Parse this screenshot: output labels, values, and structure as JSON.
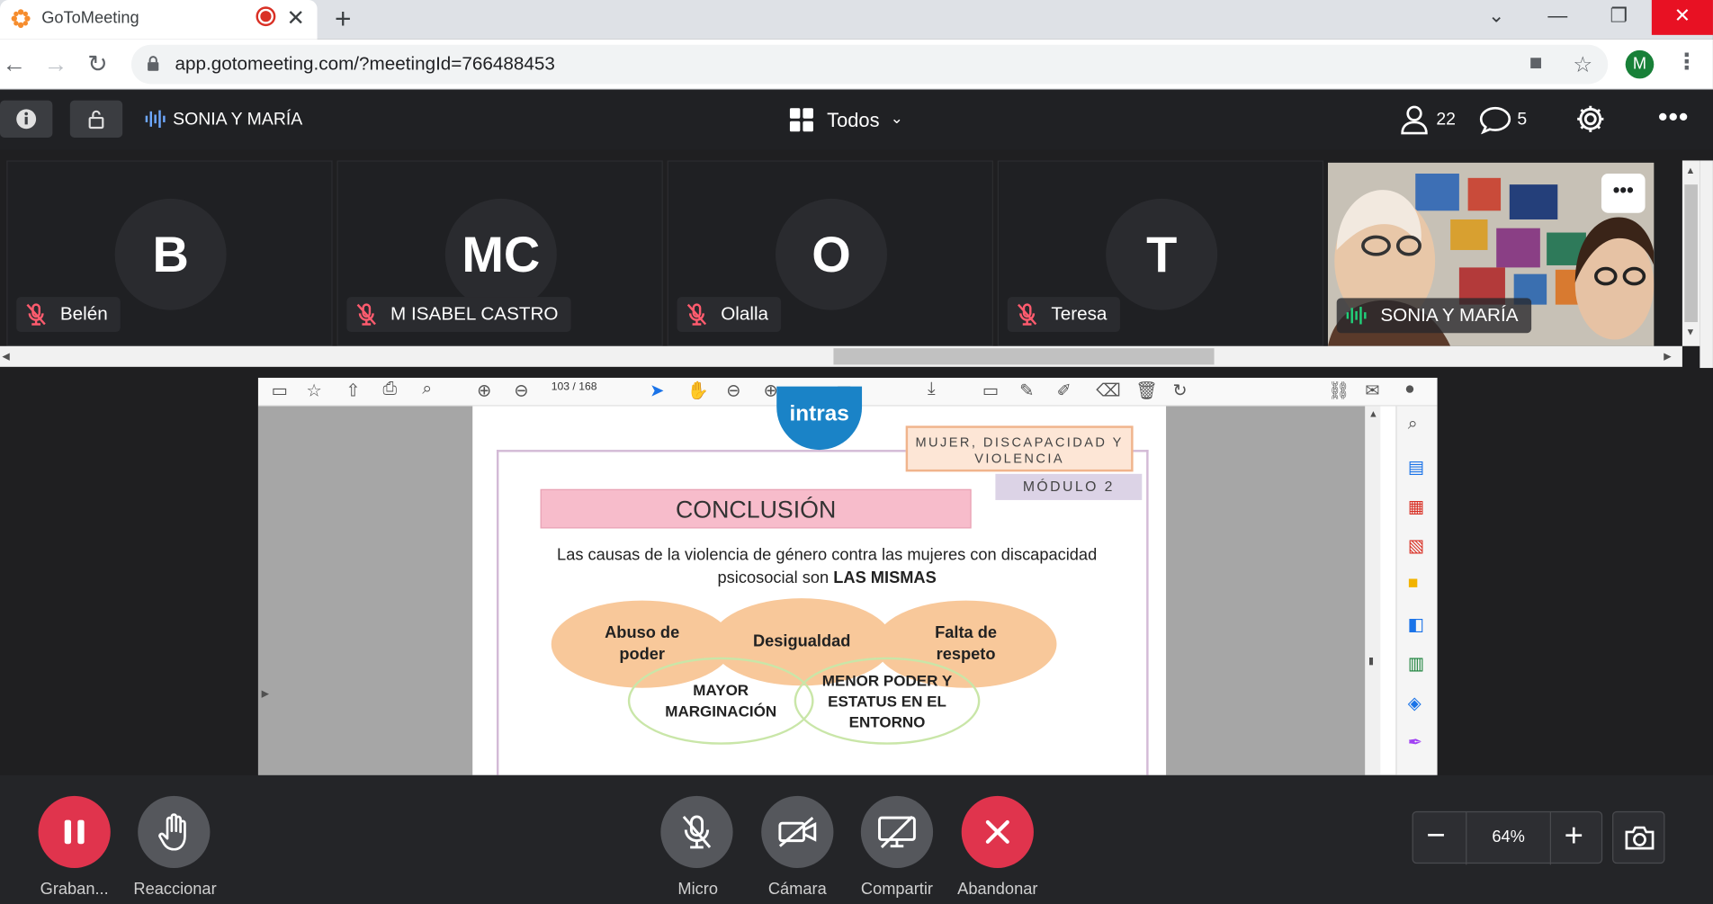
{
  "browser": {
    "tab_title": "GoToMeeting",
    "url": "app.gotomeeting.com/?meetingId=766488453",
    "profile_initial": "M"
  },
  "meeting": {
    "organizer": "SONIA Y MARÍA",
    "view_label": "Todos",
    "participants_count": "22",
    "chat_count": "5",
    "participants": [
      {
        "initials": "B",
        "name": "Belén"
      },
      {
        "initials": "MC",
        "name": "M ISABEL CASTRO"
      },
      {
        "initials": "O",
        "name": "Olalla"
      },
      {
        "initials": "T",
        "name": "Teresa"
      }
    ],
    "speaker_name": "SONIA Y MARÍA"
  },
  "pdf": {
    "page_current": "103",
    "page_total": "/ 168",
    "logo": "intras",
    "tag_top": "MUJER, DISCAPACIDAD Y VIOLENCIA",
    "tag_module": "MÓDULO 2",
    "heading": "CONCLUSIÓN",
    "body_line1": "Las causas de la violencia de género contra las mujeres con discapacidad",
    "body_line2_prefix": "psicosocial son",
    "body_line2_bold": "LAS MISMAS",
    "ellipses": {
      "abuse": "Abuso de poder",
      "inequality": "Desigualdad",
      "respect": "Falta de respeto",
      "marginalization": "MAYOR MARGINACIÓN",
      "power": "MENOR PODER Y ESTATUS EN EL ENTORNO"
    }
  },
  "controls": {
    "record": "Graban...",
    "react": "Reaccionar",
    "mic": "Micro",
    "camera": "Cámara",
    "share": "Compartir",
    "leave": "Abandonar",
    "zoom": "64%"
  },
  "colors": {
    "accent_red": "#e0344d",
    "meeting_bg": "#1f1f21",
    "pink_heading": "#f7bccb",
    "orange_ellipse": "#f8c89a"
  }
}
